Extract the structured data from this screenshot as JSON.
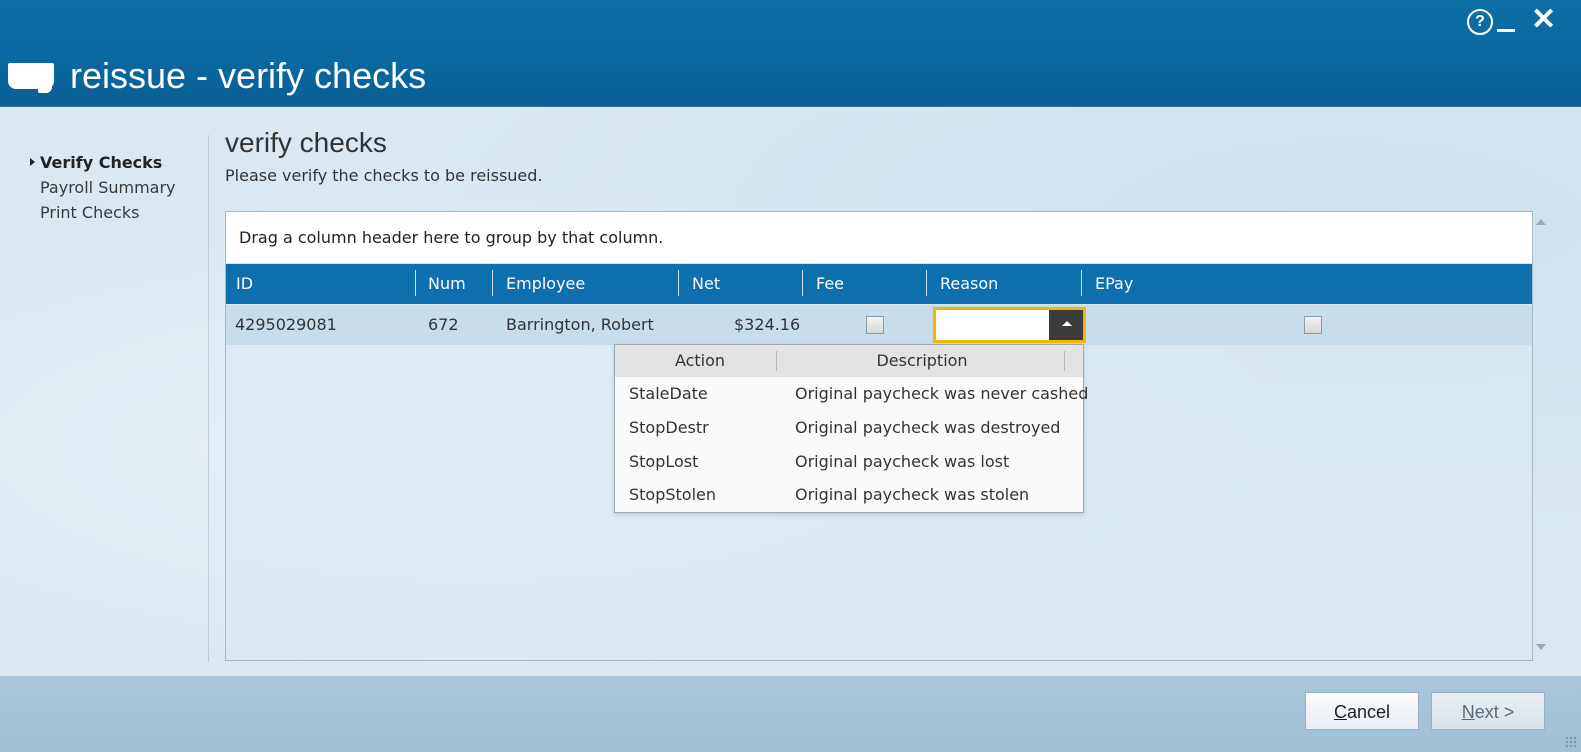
{
  "window": {
    "title": "reissue - verify checks",
    "help_glyph": "?",
    "close_glyph": "✕"
  },
  "sidebar": {
    "items": [
      {
        "label": "Verify Checks",
        "active": true
      },
      {
        "label": "Payroll Summary",
        "active": false
      },
      {
        "label": "Print Checks",
        "active": false
      }
    ]
  },
  "page": {
    "title": "verify checks",
    "subtitle": "Please verify the checks to be reissued."
  },
  "grid": {
    "group_hint": "Drag a column header here to group by that column.",
    "columns": [
      "ID",
      "Num",
      "Employee",
      "Net",
      "Fee",
      "Reason",
      "EPay"
    ],
    "rows": [
      {
        "id": "4295029081",
        "num": "672",
        "employee": "Barrington, Robert",
        "net": "$324.16",
        "fee": false,
        "reason": "",
        "epay": false
      }
    ]
  },
  "reason_dropdown": {
    "headers": [
      "Action",
      "Description"
    ],
    "options": [
      {
        "action": "StaleDate",
        "description": "Original paycheck was never cashed"
      },
      {
        "action": "StopDestr",
        "description": "Original paycheck was destroyed"
      },
      {
        "action": "StopLost",
        "description": "Original paycheck was lost"
      },
      {
        "action": "StopStolen",
        "description": "Original paycheck was stolen"
      }
    ]
  },
  "footer": {
    "cancel_rest": "ancel",
    "cancel_accel": "C",
    "next_accel": "N",
    "next_rest": "ext >"
  },
  "colors": {
    "title_bar": "#0b67a0",
    "grid_header": "#0d6fae",
    "selected_row": "#c8dcea",
    "focus_border": "#f2b705"
  }
}
